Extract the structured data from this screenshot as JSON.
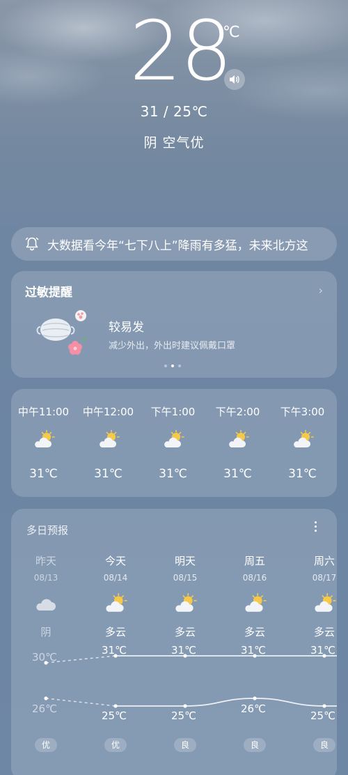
{
  "current": {
    "temperature": "28",
    "unit": "℃",
    "range": "31 / 25℃",
    "condition": "阴  空气优"
  },
  "news": {
    "text": "大数据看今年“七下八上”降雨有多猛，未来北方这"
  },
  "allergy": {
    "title": "过敏提醒",
    "level": "较易发",
    "tip": "减少外出，外出时建议佩戴口罩"
  },
  "hourly": [
    {
      "time": "中午11:00",
      "temp": "31℃",
      "icon": "partly-cloudy-icon"
    },
    {
      "time": "中午12:00",
      "temp": "31℃",
      "icon": "partly-cloudy-icon"
    },
    {
      "time": "下午1:00",
      "temp": "31℃",
      "icon": "partly-cloudy-icon"
    },
    {
      "time": "下午2:00",
      "temp": "31℃",
      "icon": "partly-cloudy-icon"
    },
    {
      "time": "下午3:00",
      "temp": "31℃",
      "icon": "partly-cloudy-icon"
    }
  ],
  "daily": {
    "title": "多日预报",
    "days": [
      {
        "day": "昨天",
        "date": "08/13",
        "weather": "阴",
        "icon": "cloudy-icon",
        "high": "30℃",
        "low": "26℃",
        "aqi": "优"
      },
      {
        "day": "今天",
        "date": "08/14",
        "weather": "多云",
        "icon": "partly-cloudy-icon",
        "high": "31℃",
        "low": "25℃",
        "aqi": "优"
      },
      {
        "day": "明天",
        "date": "08/15",
        "weather": "多云",
        "icon": "partly-cloudy-icon",
        "high": "31℃",
        "low": "25℃",
        "aqi": "良"
      },
      {
        "day": "周五",
        "date": "08/16",
        "weather": "多云",
        "icon": "partly-cloudy-icon",
        "high": "31℃",
        "low": "26℃",
        "aqi": "良"
      },
      {
        "day": "周六",
        "date": "08/17",
        "weather": "多云",
        "icon": "partly-cloudy-icon",
        "high": "31℃",
        "low": "25℃",
        "aqi": "良"
      }
    ],
    "high_values": [
      30,
      31,
      31,
      31,
      31
    ],
    "low_values": [
      26,
      25,
      25,
      26,
      25
    ]
  }
}
